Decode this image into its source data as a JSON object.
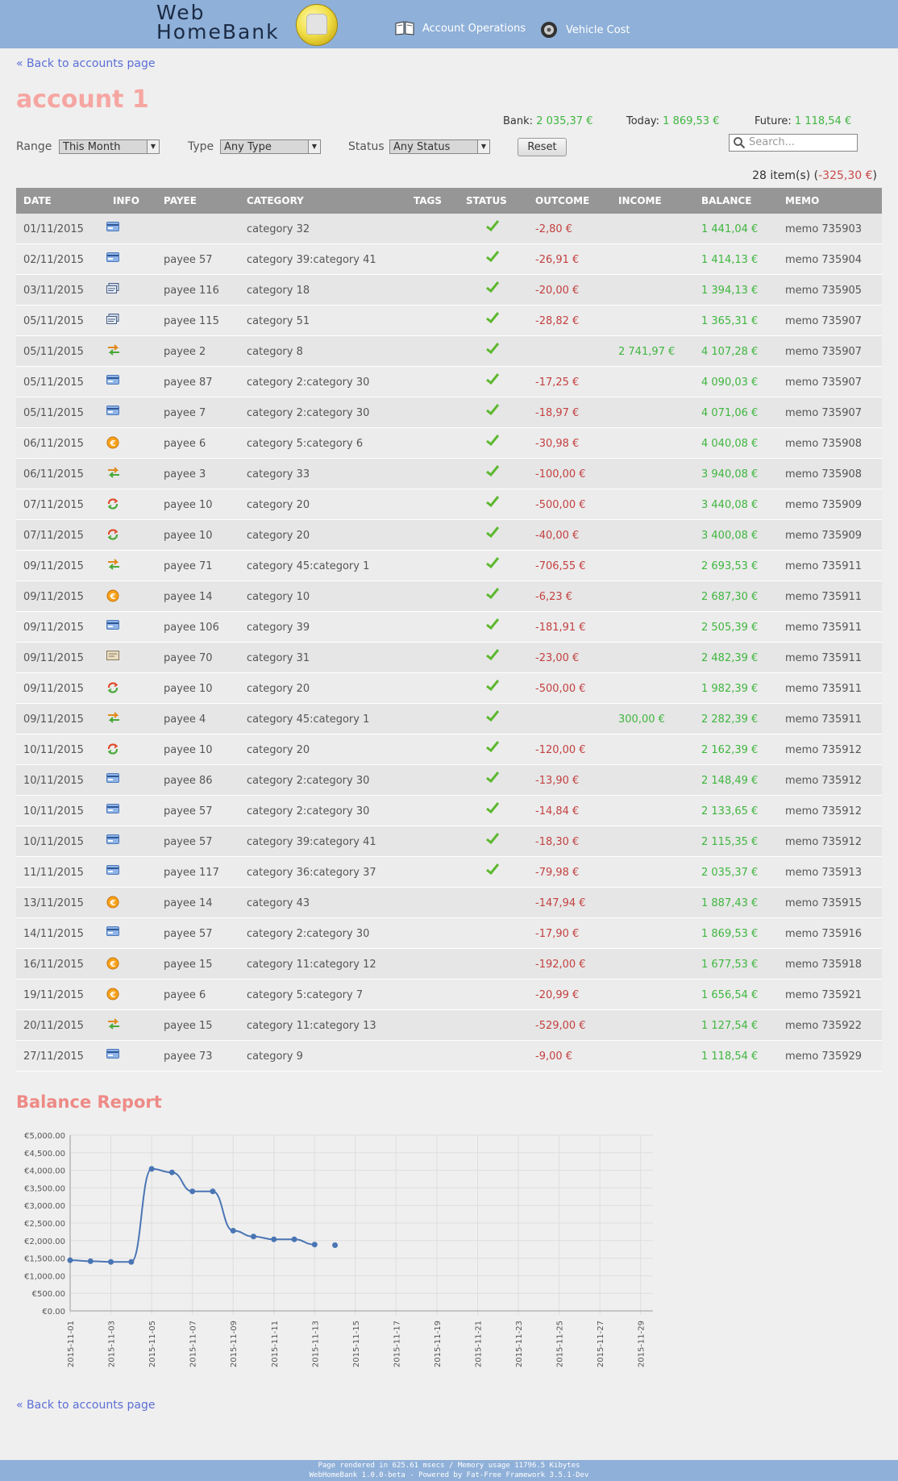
{
  "header": {
    "logo_line1": "Web",
    "logo_line2": "HomeBank",
    "nav": [
      {
        "label": "Account Operations",
        "icon": "book-icon"
      },
      {
        "label": "Vehicle Cost",
        "icon": "wheel-icon"
      }
    ]
  },
  "back_link": "« Back to accounts page",
  "account_title": "account 1",
  "totals": {
    "bank_label": "Bank:",
    "bank_value": "2 035,37 €",
    "today_label": "Today:",
    "today_value": "1 869,53 €",
    "future_label": "Future:",
    "future_value": "1 118,54 €"
  },
  "filters": {
    "range_label": "Range",
    "range_value": "This Month",
    "type_label": "Type",
    "type_value": "Any Type",
    "status_label": "Status",
    "status_value": "Any Status",
    "reset_label": "Reset",
    "search_placeholder": "Search..."
  },
  "items": {
    "count": "28 item(s) (",
    "total": "-325,30 €",
    "close": ")"
  },
  "columns": [
    "DATE",
    "INFO",
    "PAYEE",
    "CATEGORY",
    "TAGS",
    "STATUS",
    "OUTCOME",
    "INCOME",
    "BALANCE",
    "MEMO"
  ],
  "rows": [
    {
      "date": "01/11/2015",
      "info": "card",
      "payee": "",
      "category": "category 32",
      "status": "✔",
      "outcome": "-2,80 €",
      "income": "",
      "balance": "1 441,04 €",
      "memo": "memo 735903"
    },
    {
      "date": "02/11/2015",
      "info": "card",
      "payee": "payee 57",
      "category": "category 39:category 41",
      "status": "✔",
      "outcome": "-26,91 €",
      "income": "",
      "balance": "1 414,13 €",
      "memo": "memo 735904"
    },
    {
      "date": "03/11/2015",
      "info": "check",
      "payee": "payee 116",
      "category": "category 18",
      "status": "✔",
      "outcome": "-20,00 €",
      "income": "",
      "balance": "1 394,13 €",
      "memo": "memo 735905"
    },
    {
      "date": "05/11/2015",
      "info": "check",
      "payee": "payee 115",
      "category": "category 51",
      "status": "✔",
      "outcome": "-28,82 €",
      "income": "",
      "balance": "1 365,31 €",
      "memo": "memo 735907"
    },
    {
      "date": "05/11/2015",
      "info": "transfer",
      "payee": "payee 2",
      "category": "category 8",
      "status": "✔",
      "outcome": "",
      "income": "2 741,97 €",
      "balance": "4 107,28 €",
      "memo": "memo 735907"
    },
    {
      "date": "05/11/2015",
      "info": "card",
      "payee": "payee 87",
      "category": "category 2:category 30",
      "status": "✔",
      "outcome": "-17,25 €",
      "income": "",
      "balance": "4 090,03 €",
      "memo": "memo 735907"
    },
    {
      "date": "05/11/2015",
      "info": "card",
      "payee": "payee 7",
      "category": "category 2:category 30",
      "status": "✔",
      "outcome": "-18,97 €",
      "income": "",
      "balance": "4 071,06 €",
      "memo": "memo 735907"
    },
    {
      "date": "06/11/2015",
      "info": "cash",
      "payee": "payee 6",
      "category": "category 5:category 6",
      "status": "✔",
      "outcome": "-30,98 €",
      "income": "",
      "balance": "4 040,08 €",
      "memo": "memo 735908"
    },
    {
      "date": "06/11/2015",
      "info": "transfer",
      "payee": "payee 3",
      "category": "category 33",
      "status": "✔",
      "outcome": "-100,00 €",
      "income": "",
      "balance": "3 940,08 €",
      "memo": "memo 735908"
    },
    {
      "date": "07/11/2015",
      "info": "standing",
      "payee": "payee 10",
      "category": "category 20",
      "status": "✔",
      "outcome": "-500,00 €",
      "income": "",
      "balance": "3 440,08 €",
      "memo": "memo 735909"
    },
    {
      "date": "07/11/2015",
      "info": "standing",
      "payee": "payee 10",
      "category": "category 20",
      "status": "✔",
      "outcome": "-40,00 €",
      "income": "",
      "balance": "3 400,08 €",
      "memo": "memo 735909"
    },
    {
      "date": "09/11/2015",
      "info": "transfer",
      "payee": "payee 71",
      "category": "category 45:category 1",
      "status": "✔",
      "outcome": "-706,55 €",
      "income": "",
      "balance": "2 693,53 €",
      "memo": "memo 735911"
    },
    {
      "date": "09/11/2015",
      "info": "cash",
      "payee": "payee 14",
      "category": "category 10",
      "status": "✔",
      "outcome": "-6,23 €",
      "income": "",
      "balance": "2 687,30 €",
      "memo": "memo 735911"
    },
    {
      "date": "09/11/2015",
      "info": "card",
      "payee": "payee 106",
      "category": "category 39",
      "status": "✔",
      "outcome": "-181,91 €",
      "income": "",
      "balance": "2 505,39 €",
      "memo": "memo 735911"
    },
    {
      "date": "09/11/2015",
      "info": "deposit",
      "payee": "payee 70",
      "category": "category 31",
      "status": "✔",
      "outcome": "-23,00 €",
      "income": "",
      "balance": "2 482,39 €",
      "memo": "memo 735911"
    },
    {
      "date": "09/11/2015",
      "info": "standing",
      "payee": "payee 10",
      "category": "category 20",
      "status": "✔",
      "outcome": "-500,00 €",
      "income": "",
      "balance": "1 982,39 €",
      "memo": "memo 735911"
    },
    {
      "date": "09/11/2015",
      "info": "transfer",
      "payee": "payee 4",
      "category": "category 45:category 1",
      "status": "✔",
      "outcome": "",
      "income": "300,00 €",
      "balance": "2 282,39 €",
      "memo": "memo 735911"
    },
    {
      "date": "10/11/2015",
      "info": "standing",
      "payee": "payee 10",
      "category": "category 20",
      "status": "✔",
      "outcome": "-120,00 €",
      "income": "",
      "balance": "2 162,39 €",
      "memo": "memo 735912"
    },
    {
      "date": "10/11/2015",
      "info": "card",
      "payee": "payee 86",
      "category": "category 2:category 30",
      "status": "✔",
      "outcome": "-13,90 €",
      "income": "",
      "balance": "2 148,49 €",
      "memo": "memo 735912"
    },
    {
      "date": "10/11/2015",
      "info": "card",
      "payee": "payee 57",
      "category": "category 2:category 30",
      "status": "✔",
      "outcome": "-14,84 €",
      "income": "",
      "balance": "2 133,65 €",
      "memo": "memo 735912"
    },
    {
      "date": "10/11/2015",
      "info": "card",
      "payee": "payee 57",
      "category": "category 39:category 41",
      "status": "✔",
      "outcome": "-18,30 €",
      "income": "",
      "balance": "2 115,35 €",
      "memo": "memo 735912"
    },
    {
      "date": "11/11/2015",
      "info": "card",
      "payee": "payee 117",
      "category": "category 36:category 37",
      "status": "✔",
      "outcome": "-79,98 €",
      "income": "",
      "balance": "2 035,37 €",
      "memo": "memo 735913"
    },
    {
      "date": "13/11/2015",
      "info": "cash",
      "payee": "payee 14",
      "category": "category 43",
      "status": "",
      "outcome": "-147,94 €",
      "income": "",
      "balance": "1 887,43 €",
      "memo": "memo 735915"
    },
    {
      "date": "14/11/2015",
      "info": "card",
      "payee": "payee 57",
      "category": "category 2:category 30",
      "status": "",
      "outcome": "-17,90 €",
      "income": "",
      "balance": "1 869,53 €",
      "memo": "memo 735916"
    },
    {
      "date": "16/11/2015",
      "info": "cash",
      "payee": "payee 15",
      "category": "category 11:category 12",
      "status": "",
      "outcome": "-192,00 €",
      "income": "",
      "balance": "1 677,53 €",
      "memo": "memo 735918"
    },
    {
      "date": "19/11/2015",
      "info": "cash",
      "payee": "payee 6",
      "category": "category 5:category 7",
      "status": "",
      "outcome": "-20,99 €",
      "income": "",
      "balance": "1 656,54 €",
      "memo": "memo 735921"
    },
    {
      "date": "20/11/2015",
      "info": "transfer",
      "payee": "payee 15",
      "category": "category 11:category 13",
      "status": "",
      "outcome": "-529,00 €",
      "income": "",
      "balance": "1 127,54 €",
      "memo": "memo 735922"
    },
    {
      "date": "27/11/2015",
      "info": "card",
      "payee": "payee 73",
      "category": "category 9",
      "status": "",
      "outcome": "-9,00 €",
      "income": "",
      "balance": "1 118,54 €",
      "memo": "memo 735929"
    }
  ],
  "report_title": "Balance Report",
  "chart_data": {
    "type": "line",
    "title": "Balance Report",
    "ylim": [
      0,
      5000
    ],
    "yticks": [
      "€0.00",
      "€500.00",
      "€1,000.00",
      "€1,500.00",
      "€2,000.00",
      "€2,500.00",
      "€3,000.00",
      "€3,500.00",
      "€4,000.00",
      "€4,500.00",
      "€5,000.00"
    ],
    "xticks": [
      "2015-11-01",
      "2015-11-03",
      "2015-11-05",
      "2015-11-07",
      "2015-11-09",
      "2015-11-11",
      "2015-11-13",
      "2015-11-15",
      "2015-11-17",
      "2015-11-19",
      "2015-11-21",
      "2015-11-23",
      "2015-11-25",
      "2015-11-27",
      "2015-11-29"
    ],
    "x": [
      "2015-11-01",
      "2015-11-02",
      "2015-11-03",
      "2015-11-04",
      "2015-11-05",
      "2015-11-06",
      "2015-11-07",
      "2015-11-08",
      "2015-11-09",
      "2015-11-10",
      "2015-11-11",
      "2015-11-12",
      "2015-11-13",
      "2015-11-14"
    ],
    "series": [
      {
        "values": [
          1441.04,
          1414.13,
          1394.13,
          1394.13,
          4040.08,
          3940.08,
          3400.08,
          3400.08,
          2282.39,
          2115.35,
          2035.37,
          2035.37,
          1887.43,
          1869.53
        ]
      }
    ],
    "line_color": "#4a75b5",
    "grid": true
  },
  "footer": {
    "line1": "Page rendered in 625.61 msecs / Memory usage 11796.5 Kibytes",
    "line2": "WebHomeBank 1.0.0-beta - Powered by Fat-Free Framework 3.5.1-Dev"
  }
}
